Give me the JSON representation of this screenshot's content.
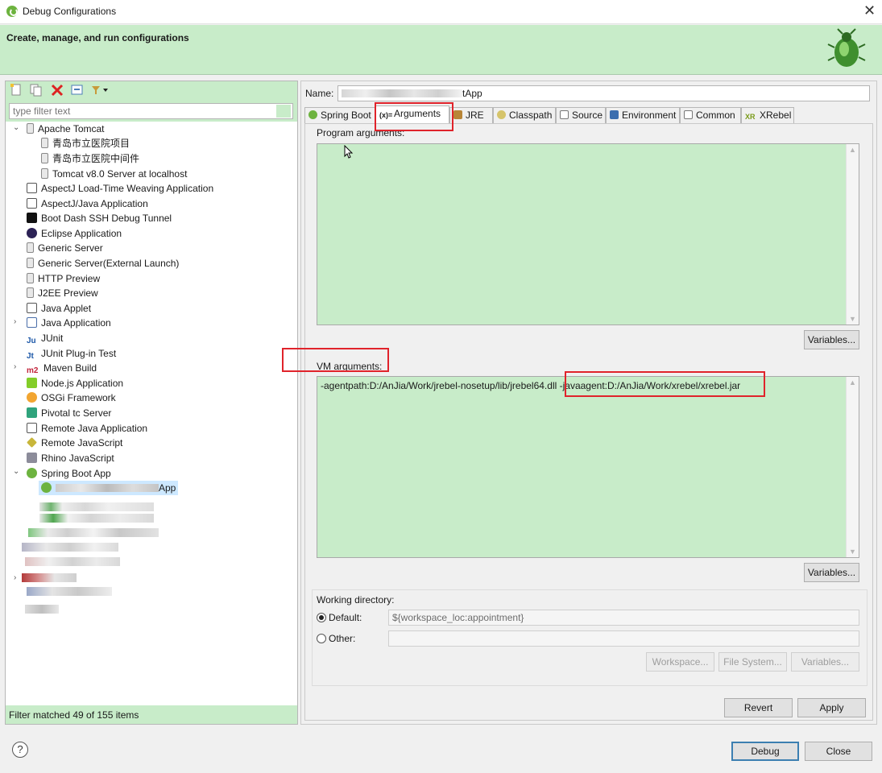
{
  "window": {
    "title": "Debug Configurations",
    "close": "✕"
  },
  "header": {
    "title": "Create, manage, and run configurations"
  },
  "left": {
    "filter_placeholder": "type filter text",
    "status": "Filter matched 49 of 155 items",
    "tree": [
      {
        "label": "Apache Tomcat",
        "icon": "tomcat-icon",
        "expanded": true
      },
      {
        "label": "青岛市立医院项目",
        "icon": "server-icon"
      },
      {
        "label": "青岛市立医院中间件",
        "icon": "server-icon"
      },
      {
        "label": "Tomcat v8.0 Server at localhost",
        "icon": "server-icon"
      },
      {
        "label": "AspectJ Load-Time Weaving Application",
        "icon": "ltw-icon"
      },
      {
        "label": "AspectJ/Java Application",
        "icon": "aj-icon"
      },
      {
        "label": "Boot Dash SSH Debug Tunnel",
        "icon": "boot-dash-icon"
      },
      {
        "label": "Eclipse Application",
        "icon": "eclipse-icon"
      },
      {
        "label": "Generic Server",
        "icon": "server-icon"
      },
      {
        "label": "Generic Server(External Launch)",
        "icon": "server-icon"
      },
      {
        "label": "HTTP Preview",
        "icon": "server-icon"
      },
      {
        "label": "J2EE Preview",
        "icon": "server-icon"
      },
      {
        "label": "Java Applet",
        "icon": "applet-icon"
      },
      {
        "label": "Java Application",
        "icon": "java-app-icon",
        "expandable": true
      },
      {
        "label": "JUnit",
        "icon": "junit-icon"
      },
      {
        "label": "JUnit Plug-in Test",
        "icon": "junit-plugin-icon"
      },
      {
        "label": "Maven Build",
        "icon": "maven-icon",
        "expandable": true
      },
      {
        "label": "Node.js Application",
        "icon": "nodejs-icon"
      },
      {
        "label": "OSGi Framework",
        "icon": "osgi-icon"
      },
      {
        "label": "Pivotal tc Server",
        "icon": "pivotal-icon"
      },
      {
        "label": "Remote Java Application",
        "icon": "remote-java-icon"
      },
      {
        "label": "Remote JavaScript",
        "icon": "remote-js-icon"
      },
      {
        "label": "Rhino JavaScript",
        "icon": "rhino-icon"
      },
      {
        "label": "Spring Boot App",
        "icon": "spring-icon",
        "expanded": true
      },
      {
        "label": "App",
        "icon": "spring-app-icon",
        "selected": true
      }
    ]
  },
  "right": {
    "name_label": "Name:",
    "name_value": "tApp",
    "tabs": [
      {
        "label": "Spring Boot",
        "icon": "spring-icon"
      },
      {
        "label": "Arguments",
        "icon": "arguments-icon",
        "active": true
      },
      {
        "label": "JRE",
        "icon": "jre-icon"
      },
      {
        "label": "Classpath",
        "icon": "classpath-icon"
      },
      {
        "label": "Source",
        "icon": "source-icon"
      },
      {
        "label": "Environment",
        "icon": "environment-icon"
      },
      {
        "label": "Common",
        "icon": "common-icon"
      },
      {
        "label": "XRebel",
        "icon": "xrebel-icon"
      }
    ],
    "program_args_label": "Program arguments:",
    "program_args_value": "",
    "vm_args_label": "VM arguments:",
    "vm_args_value": "-agentpath:D:/AnJia/Work/jrebel-nosetup/lib/jrebel64.dll -javaagent:D:/AnJia/Work/xrebel/xrebel.jar",
    "variables_label": "Variables...",
    "working_dir": {
      "label": "Working directory:",
      "default_label": "Default:",
      "default_value": "${workspace_loc:appointment}",
      "other_label": "Other:",
      "workspace_btn": "Workspace...",
      "filesystem_btn": "File System...",
      "variables_btn": "Variables..."
    },
    "revert": "Revert",
    "apply": "Apply"
  },
  "footer": {
    "help": "?",
    "debug": "Debug",
    "close": "Close"
  },
  "colors": {
    "accent_bg": "#c8ecc9",
    "highlight_red": "#e0232b",
    "spring_green": "#6db33f"
  }
}
